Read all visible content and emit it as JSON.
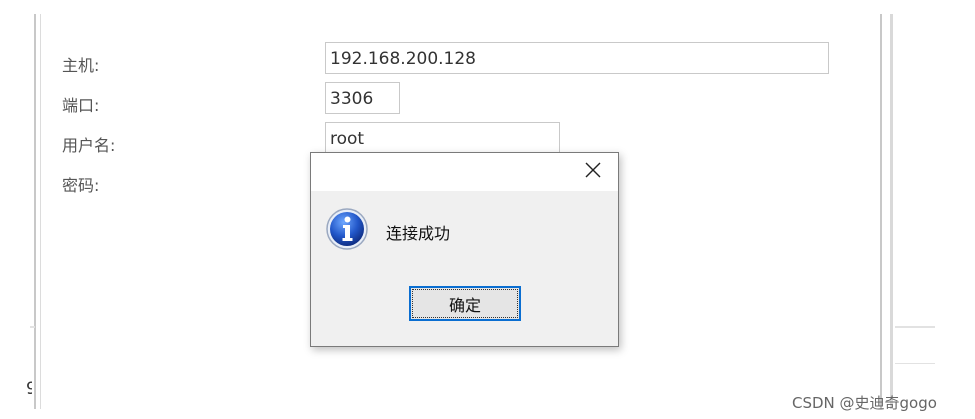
{
  "form": {
    "host_label": "主机:",
    "host_value": "192.168.200.128",
    "port_label": "端口:",
    "port_value": "3306",
    "user_label": "用户名:",
    "user_value": "root",
    "password_label": "密码:"
  },
  "dialog": {
    "message": "连接成功",
    "ok_label": "确定",
    "close_symbol": "✕",
    "icon": "info-icon"
  },
  "watermark": "CSDN @史迪奇gogo",
  "cut_char": "9"
}
